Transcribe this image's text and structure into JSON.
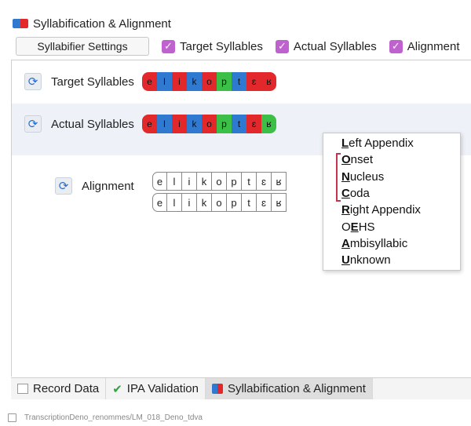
{
  "window": {
    "title": "Syllabification & Alignment"
  },
  "toolbar": {
    "settings_label": "Syllabifier Settings",
    "checkboxes": [
      {
        "label": "Target Syllables",
        "checked": true
      },
      {
        "label": "Actual Syllables",
        "checked": true
      },
      {
        "label": "Alignment",
        "checked": true
      }
    ]
  },
  "rows": {
    "target": {
      "label": "Target Syllables",
      "phones": [
        {
          "text": "e",
          "color": "red"
        },
        {
          "text": "l",
          "color": "blue"
        },
        {
          "text": "i",
          "color": "red"
        },
        {
          "text": "k",
          "color": "blue"
        },
        {
          "text": "o",
          "color": "red"
        },
        {
          "text": "p",
          "color": "green"
        },
        {
          "text": "t",
          "color": "blue"
        },
        {
          "text": "ɛ",
          "color": "red"
        },
        {
          "text": "ʁ",
          "color": "red"
        }
      ]
    },
    "actual": {
      "label": "Actual Syllables",
      "phones": [
        {
          "text": "e",
          "color": "red"
        },
        {
          "text": "l",
          "color": "blue"
        },
        {
          "text": "i",
          "color": "red"
        },
        {
          "text": "k",
          "color": "blue"
        },
        {
          "text": "o",
          "color": "red"
        },
        {
          "text": "p",
          "color": "green"
        },
        {
          "text": "t",
          "color": "blue"
        },
        {
          "text": "ɛ",
          "color": "red"
        },
        {
          "text": "ʁ",
          "color": "green"
        }
      ]
    },
    "alignment": {
      "label": "Alignment",
      "top": [
        "e",
        "l",
        "i",
        "k",
        "o",
        "p",
        "t",
        "ɛ",
        "ʁ"
      ],
      "bottom": [
        "e",
        "l",
        "i",
        "k",
        "o",
        "p",
        "t",
        "ɛ",
        "ʁ"
      ]
    }
  },
  "context_menu": {
    "items": [
      {
        "mnemonic": "L",
        "rest": "eft Appendix"
      },
      {
        "mnemonic": "O",
        "rest": "nset"
      },
      {
        "mnemonic": "N",
        "rest": "ucleus"
      },
      {
        "mnemonic": "C",
        "rest": "oda"
      },
      {
        "mnemonic": "R",
        "rest": "ight Appendix"
      },
      {
        "prefix": "O",
        "mnemonic": "E",
        "rest": "HS"
      },
      {
        "mnemonic": "A",
        "rest": "mbisyllabic"
      },
      {
        "mnemonic": "U",
        "rest": "nknown"
      }
    ],
    "bracket_color": "#c4344e"
  },
  "tabs": [
    {
      "label": "Record Data",
      "icon": "record-data-icon",
      "active": false
    },
    {
      "label": "IPA Validation",
      "icon": "checkmark-icon",
      "active": false
    },
    {
      "label": "Syllabification & Alignment",
      "icon": "syllabification-icon",
      "active": true
    }
  ],
  "status": {
    "path": "TranscriptionDeno_renommes/LM_018_Deno_tdva"
  },
  "colors": {
    "red": "#e3282b",
    "blue": "#2f79d0",
    "green": "#3bbf47",
    "checkbox": "#bf61cf"
  }
}
